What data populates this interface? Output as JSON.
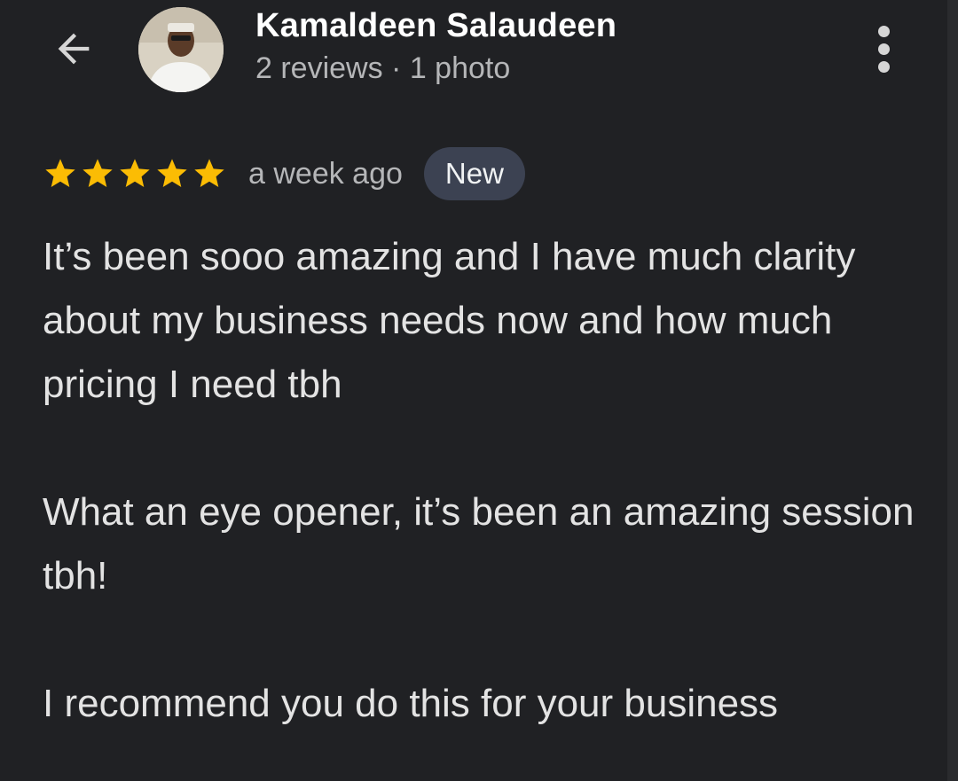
{
  "header": {
    "back_icon": "arrow-back-icon",
    "reviewer_name": "Kamaldeen Salaudeen",
    "reviewer_meta": "2 reviews · 1 photo",
    "more_icon": "more-vert-icon"
  },
  "review": {
    "rating": 5,
    "rating_max": 5,
    "star_color": "#fbbc04",
    "time_ago": "a week ago",
    "badge": "New",
    "paragraphs": [
      "It’s been sooo amazing and I have much clarity about my business needs now and how much pricing I need tbh",
      "What an eye opener, it’s been an amazing session tbh!",
      "I recommend you do this for your business"
    ]
  }
}
